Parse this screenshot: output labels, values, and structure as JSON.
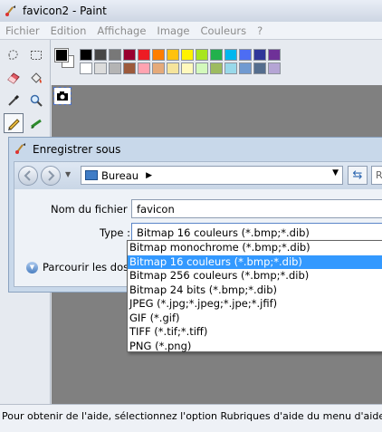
{
  "window": {
    "title": "favicon2 - Paint"
  },
  "menu": [
    "Fichier",
    "Edition",
    "Affichage",
    "Image",
    "Couleurs",
    "?"
  ],
  "tools": [
    {
      "name": "free-select-icon"
    },
    {
      "name": "rect-select-icon"
    },
    {
      "name": "eraser-icon"
    },
    {
      "name": "fill-icon"
    },
    {
      "name": "color-picker-icon"
    },
    {
      "name": "magnifier-icon"
    },
    {
      "name": "pencil-icon",
      "active": true
    },
    {
      "name": "brush-icon"
    }
  ],
  "palette": {
    "foreground": "#000000",
    "background": "#ffffff",
    "row1": [
      "#000000",
      "#464646",
      "#787878",
      "#990030",
      "#ed1c24",
      "#ff7e00",
      "#ffc20e",
      "#fff200",
      "#a8e61d",
      "#22b14c",
      "#00b7ef",
      "#4d6df3",
      "#2f3699",
      "#6f3198"
    ],
    "row2": [
      "#ffffff",
      "#dcdcdc",
      "#b4b4b4",
      "#9c5a3c",
      "#ffa3b1",
      "#e5aa7a",
      "#f5e49c",
      "#fff9bd",
      "#d3f9bc",
      "#9dbb61",
      "#99d9ea",
      "#709ad1",
      "#546d8e",
      "#b5a5d5"
    ]
  },
  "dialog": {
    "title": "Enregistrer sous",
    "location": "Bureau",
    "search_placeholder": "R",
    "filename_label": "Nom du fichier :",
    "filename_value": "favicon",
    "type_label": "Type :",
    "type_value": "Bitmap 16 couleurs (*.bmp;*.dib)",
    "browse_label": "Parcourir les doss"
  },
  "type_options": [
    {
      "label": "Bitmap monochrome (*.bmp;*.dib)",
      "selected": false
    },
    {
      "label": "Bitmap 16 couleurs (*.bmp;*.dib)",
      "selected": true
    },
    {
      "label": "Bitmap 256 couleurs (*.bmp;*.dib)",
      "selected": false
    },
    {
      "label": "Bitmap 24 bits (*.bmp;*.dib)",
      "selected": false
    },
    {
      "label": "JPEG (*.jpg;*.jpeg;*.jpe;*.jfif)",
      "selected": false
    },
    {
      "label": "GIF (*.gif)",
      "selected": false
    },
    {
      "label": "TIFF (*.tif;*.tiff)",
      "selected": false
    },
    {
      "label": "PNG (*.png)",
      "selected": false
    }
  ],
  "status": "Pour obtenir de l'aide, sélectionnez l'option Rubriques d'aide du menu d'aide."
}
